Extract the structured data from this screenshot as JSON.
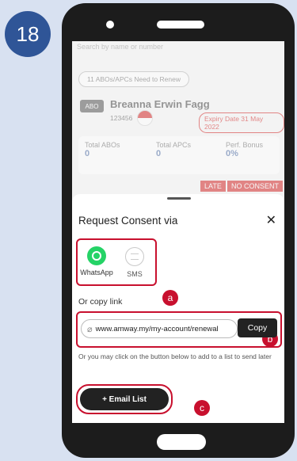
{
  "step_number": "18",
  "background_screen": {
    "search_placeholder": "Search by name or number",
    "renew_pill": "11 ABOs/APCs Need to Renew",
    "abo_tag": "ABO",
    "member_name": "Breanna Erwin Fagg",
    "member_id": "123456",
    "expiry": "Expiry Date 31 May 2022",
    "stats": [
      {
        "label": "Total ABOs",
        "value": "0"
      },
      {
        "label": "Total APCs",
        "value": "0"
      },
      {
        "label": "Perf. Bonus",
        "value": "0%"
      }
    ],
    "status_late": "LATE",
    "status_consent": "NO CONSENT"
  },
  "sheet": {
    "title": "Request Consent via",
    "close_icon": "close-icon",
    "options": [
      {
        "label": "WhatsApp",
        "icon": "whatsapp-icon"
      },
      {
        "label": "SMS",
        "icon": "sms-icon"
      }
    ],
    "or_copy_label": "Or copy link",
    "link_value": "www.amway.my/my-account/renewal",
    "copy_label": "Copy",
    "hint": "Or you may click on the button below to add to a list to send later",
    "email_button": "+ Email List"
  },
  "callouts": [
    "a",
    "b",
    "c"
  ],
  "colors": {
    "accent_red": "#c8102e",
    "badge_blue": "#2f5597",
    "whatsapp_green": "#25d366"
  }
}
